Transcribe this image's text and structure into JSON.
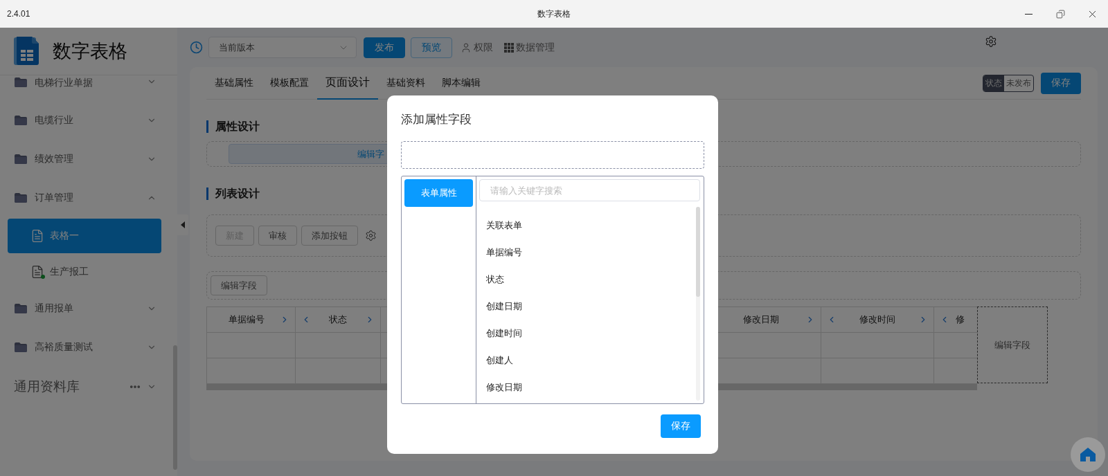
{
  "window": {
    "version": "2.4.01",
    "title": "数字表格"
  },
  "sidebar": {
    "app_name": "数字表格",
    "items": [
      {
        "label": "电梯行业单据",
        "expanded": false
      },
      {
        "label": "电缆行业",
        "expanded": false
      },
      {
        "label": "绩效管理",
        "expanded": false
      },
      {
        "label": "订单管理",
        "expanded": true,
        "children": [
          {
            "label": "表格一",
            "selected": true,
            "dot": false
          },
          {
            "label": "生产报工",
            "selected": false,
            "dot": true
          }
        ]
      },
      {
        "label": "通用报单",
        "expanded": false
      },
      {
        "label": "高裕质量测试",
        "expanded": false
      }
    ],
    "library": {
      "label": "通用资料库",
      "expanded": false
    }
  },
  "toolbar": {
    "version_select": {
      "value": "当前版本"
    },
    "buttons": [
      {
        "label": "发布",
        "kind": "primary"
      },
      {
        "label": "预览",
        "kind": "outline"
      },
      {
        "label": "权限",
        "kind": "user"
      },
      {
        "label": "数据管理",
        "kind": "grid"
      }
    ]
  },
  "tabs": [
    {
      "label": "基础属性",
      "selected": false
    },
    {
      "label": "模板配置",
      "selected": false
    },
    {
      "label": "页面设计",
      "selected": true
    },
    {
      "label": "基础资料",
      "selected": false
    },
    {
      "label": "脚本编辑",
      "selected": false
    }
  ],
  "status": {
    "label": "状态",
    "value": "未发布"
  },
  "save_button": "保存",
  "attribute_design": {
    "title": "属性设计",
    "bar_label": "编辑字"
  },
  "list_design": {
    "title": "列表设计",
    "buttons": [
      {
        "label": "新建",
        "disabled": true
      },
      {
        "label": "审核",
        "disabled": false
      },
      {
        "label": "添加按钮",
        "disabled": false
      }
    ],
    "edit_fields_button": "编辑字段"
  },
  "table": {
    "columns": [
      {
        "label": "单据编号",
        "prev_arrow": false,
        "next_arrow": true
      },
      {
        "label": "状态",
        "prev_arrow": true,
        "next_arrow": true
      },
      {
        "label": "修改日期",
        "prev_arrow": false,
        "next_arrow": true
      },
      {
        "label": "修改时间",
        "prev_arrow": true,
        "next_arrow": true
      },
      {
        "label": "修",
        "prev_arrow": true,
        "next_arrow": false
      }
    ],
    "edit_fields_column": "编辑字段"
  },
  "dialog": {
    "title": "添加属性字段",
    "categories": [
      {
        "label": "表单属性",
        "selected": true
      }
    ],
    "search": {
      "placeholder": "请输入关键字搜索"
    },
    "fields": [
      "关联表单",
      "单据编号",
      "状态",
      "创建日期",
      "创建时间",
      "创建人",
      "修改日期"
    ],
    "save_button": "保存"
  }
}
